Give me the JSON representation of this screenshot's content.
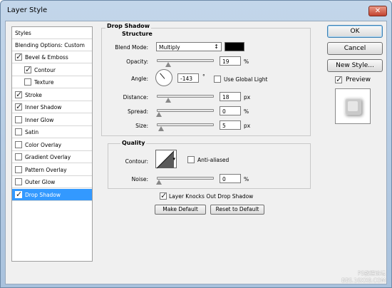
{
  "window": {
    "title": "Layer Style",
    "close_glyph": "✕"
  },
  "styles_list": {
    "header": "Styles",
    "blending": "Blending Options: Custom",
    "items": [
      {
        "label": "Bevel & Emboss",
        "checked": true,
        "indent": false
      },
      {
        "label": "Contour",
        "checked": true,
        "indent": true
      },
      {
        "label": "Texture",
        "checked": false,
        "indent": true
      },
      {
        "label": "Stroke",
        "checked": true,
        "indent": false
      },
      {
        "label": "Inner Shadow",
        "checked": true,
        "indent": false
      },
      {
        "label": "Inner Glow",
        "checked": false,
        "indent": false
      },
      {
        "label": "Satin",
        "checked": false,
        "indent": false
      },
      {
        "label": "Color Overlay",
        "checked": false,
        "indent": false
      },
      {
        "label": "Gradient Overlay",
        "checked": false,
        "indent": false
      },
      {
        "label": "Pattern Overlay",
        "checked": false,
        "indent": false
      },
      {
        "label": "Outer Glow",
        "checked": false,
        "indent": false
      },
      {
        "label": "Drop Shadow",
        "checked": true,
        "indent": false,
        "selected": true
      }
    ]
  },
  "drop_shadow": {
    "title": "Drop Shadow",
    "structure": {
      "legend": "Structure",
      "blend_mode_label": "Blend Mode:",
      "blend_mode_value": "Multiply",
      "shadow_color": "#000000",
      "opacity_label": "Opacity:",
      "opacity_value": "19",
      "opacity_unit": "%",
      "angle_label": "Angle:",
      "angle_value": "-143",
      "angle_unit": "°",
      "global_light_label": "Use Global Light",
      "global_light_checked": false,
      "distance_label": "Distance:",
      "distance_value": "18",
      "distance_unit": "px",
      "spread_label": "Spread:",
      "spread_value": "0",
      "spread_unit": "%",
      "size_label": "Size:",
      "size_value": "5",
      "size_unit": "px"
    },
    "quality": {
      "legend": "Quality",
      "contour_label": "Contour:",
      "anti_aliased_label": "Anti-aliased",
      "anti_aliased_checked": false,
      "noise_label": "Noise:",
      "noise_value": "0",
      "noise_unit": "%"
    },
    "knocks_out_label": "Layer Knocks Out Drop Shadow",
    "knocks_out_checked": true,
    "make_default": "Make Default",
    "reset_default": "Reset to Default"
  },
  "actions": {
    "ok": "OK",
    "cancel": "Cancel",
    "new_style": "New Style...",
    "preview_label": "Preview",
    "preview_checked": true
  },
  "watermark": {
    "line1": "PS教程论坛",
    "line2": "BBS.16XX8.COM"
  }
}
